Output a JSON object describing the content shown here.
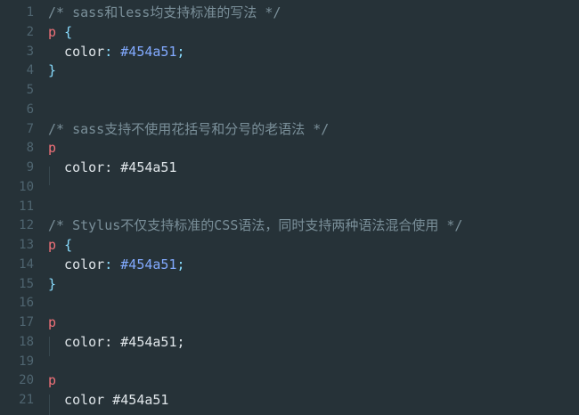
{
  "editor": {
    "lines": [
      {
        "n": "1",
        "segs": [
          {
            "t": "/* sass和less均支持标准的写法 */",
            "c": "cmt"
          }
        ]
      },
      {
        "n": "2",
        "segs": [
          {
            "t": "p",
            "c": "sel"
          },
          {
            "t": " ",
            "c": "prop"
          },
          {
            "t": "{",
            "c": "brace"
          }
        ]
      },
      {
        "n": "3",
        "segs": [
          {
            "t": "  color",
            "c": "prop"
          },
          {
            "t": ": ",
            "c": "punc"
          },
          {
            "t": "#454a51",
            "c": "val-hl"
          },
          {
            "t": ";",
            "c": "punc"
          }
        ]
      },
      {
        "n": "4",
        "segs": [
          {
            "t": "}",
            "c": "brace"
          }
        ]
      },
      {
        "n": "5",
        "segs": []
      },
      {
        "n": "6",
        "segs": []
      },
      {
        "n": "7",
        "segs": [
          {
            "t": "/* sass支持不使用花括号和分号的老语法 */",
            "c": "cmt"
          }
        ]
      },
      {
        "n": "8",
        "segs": [
          {
            "t": "p",
            "c": "sel"
          }
        ]
      },
      {
        "n": "9",
        "segs": [
          {
            "t": "  color: #454a51",
            "c": "val-plain"
          }
        ]
      },
      {
        "n": "10",
        "segs": []
      },
      {
        "n": "11",
        "segs": []
      },
      {
        "n": "12",
        "segs": [
          {
            "t": "/* Stylus不仅支持标准的CSS语法，同时支持两种语法混合使用 */",
            "c": "cmt"
          }
        ]
      },
      {
        "n": "13",
        "segs": [
          {
            "t": "p",
            "c": "sel"
          },
          {
            "t": " ",
            "c": "prop"
          },
          {
            "t": "{",
            "c": "brace"
          }
        ]
      },
      {
        "n": "14",
        "segs": [
          {
            "t": "  color",
            "c": "prop"
          },
          {
            "t": ": ",
            "c": "punc"
          },
          {
            "t": "#454a51",
            "c": "val-hl"
          },
          {
            "t": ";",
            "c": "punc"
          }
        ]
      },
      {
        "n": "15",
        "segs": [
          {
            "t": "}",
            "c": "brace"
          }
        ]
      },
      {
        "n": "16",
        "segs": []
      },
      {
        "n": "17",
        "segs": [
          {
            "t": "p",
            "c": "sel"
          }
        ]
      },
      {
        "n": "18",
        "segs": [
          {
            "t": "  color: #454a51;",
            "c": "val-plain"
          }
        ]
      },
      {
        "n": "19",
        "segs": []
      },
      {
        "n": "20",
        "segs": [
          {
            "t": "p",
            "c": "sel"
          }
        ]
      },
      {
        "n": "21",
        "segs": [
          {
            "t": "  color #454a51",
            "c": "val-plain"
          }
        ]
      }
    ]
  },
  "colors": {
    "background": "#263238",
    "gutter": "#4f6570",
    "comment": "#7a8f99",
    "selector": "#f07178",
    "punctuation": "#89ddff",
    "value": "#82aaff",
    "text": "#e0e6ea"
  }
}
